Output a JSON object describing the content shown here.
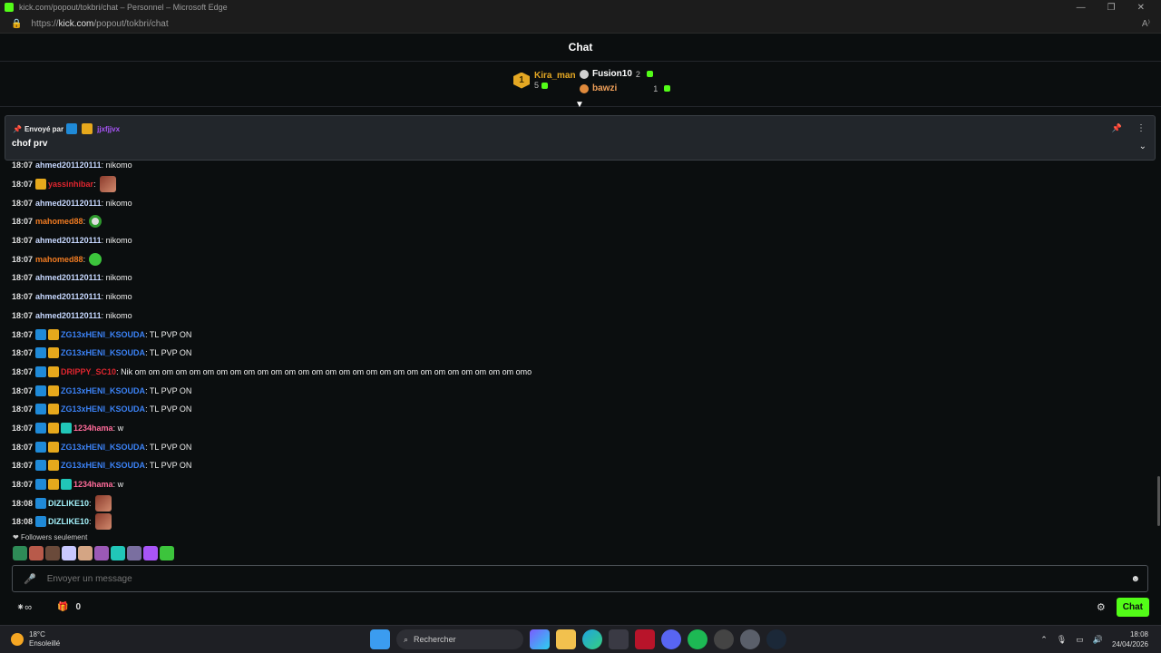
{
  "window": {
    "title": "kick.com/popout/tokbri/chat – Personnel – Microsoft Edge",
    "url_prefix": "https://",
    "url_host": "kick.com",
    "url_path": "/popout/tokbri/chat"
  },
  "header": {
    "title": "Chat"
  },
  "leaderboard": {
    "first": {
      "rank": "1",
      "name": "Kira_man",
      "count": "5"
    },
    "second": {
      "name": "Fusion10",
      "count": "2"
    },
    "third": {
      "name": "bawzi",
      "count": "1"
    }
  },
  "pinned": {
    "by_label": "Envoyé par",
    "by_user": "jjxfjjvx",
    "message": "chof prv"
  },
  "messages": [
    {
      "time": "18:07",
      "user": "ahmed201120111",
      "text": ": nikomo",
      "color": "#c7d8ff",
      "badges": [],
      "emote": ""
    },
    {
      "time": "18:07",
      "user": "yassinhibar",
      "text": ":",
      "color": "#e0262f",
      "badges": [
        "crown"
      ],
      "emote": "face"
    },
    {
      "time": "18:07",
      "user": "ahmed201120111",
      "text": ": nikomo",
      "color": "#c7d8ff",
      "badges": [],
      "emote": ""
    },
    {
      "time": "18:07",
      "user": "mahomed88",
      "text": ":",
      "color": "#f07b22",
      "badges": [],
      "emote": "skull"
    },
    {
      "time": "18:07",
      "user": "ahmed201120111",
      "text": ": nikomo",
      "color": "#c7d8ff",
      "badges": [],
      "emote": ""
    },
    {
      "time": "18:07",
      "user": "mahomed88",
      "text": ":",
      "color": "#f07b22",
      "badges": [],
      "emote": "green"
    },
    {
      "time": "18:07",
      "user": "ahmed201120111",
      "text": ": nikomo",
      "color": "#c7d8ff",
      "badges": [],
      "emote": ""
    },
    {
      "time": "18:07",
      "user": "ahmed201120111",
      "text": ": nikomo",
      "color": "#c7d8ff",
      "badges": [],
      "emote": ""
    },
    {
      "time": "18:07",
      "user": "ahmed201120111",
      "text": ": nikomo",
      "color": "#c7d8ff",
      "badges": [],
      "emote": ""
    },
    {
      "time": "18:07",
      "user": "ZG13xHENI_KSOUDA",
      "text": ": TL PVP ON",
      "color": "#3b82f6",
      "badges": [
        "blue",
        "crown"
      ],
      "emote": ""
    },
    {
      "time": "18:07",
      "user": "ZG13xHENI_KSOUDA",
      "text": ": TL PVP ON",
      "color": "#3b82f6",
      "badges": [
        "blue",
        "crown"
      ],
      "emote": ""
    },
    {
      "time": "18:07",
      "user": "DRIPPY_SC10",
      "text": ": Nik om om om om om om om om om om om om om om om om om om om om om om om om om om om om omo",
      "color": "#e0262f",
      "badges": [
        "blue",
        "crown"
      ],
      "emote": ""
    },
    {
      "time": "18:07",
      "user": "ZG13xHENI_KSOUDA",
      "text": ": TL PVP ON",
      "color": "#3b82f6",
      "badges": [
        "blue",
        "crown"
      ],
      "emote": ""
    },
    {
      "time": "18:07",
      "user": "ZG13xHENI_KSOUDA",
      "text": ": TL PVP ON",
      "color": "#3b82f6",
      "badges": [
        "blue",
        "crown"
      ],
      "emote": ""
    },
    {
      "time": "18:07",
      "user": "1234hama",
      "text": ": w",
      "color": "#ff6b9a",
      "badges": [
        "blue",
        "crown",
        "teal"
      ],
      "emote": ""
    },
    {
      "time": "18:07",
      "user": "ZG13xHENI_KSOUDA",
      "text": ": TL PVP ON",
      "color": "#3b82f6",
      "badges": [
        "blue",
        "crown"
      ],
      "emote": ""
    },
    {
      "time": "18:07",
      "user": "ZG13xHENI_KSOUDA",
      "text": ": TL PVP ON",
      "color": "#3b82f6",
      "badges": [
        "blue",
        "crown"
      ],
      "emote": ""
    },
    {
      "time": "18:07",
      "user": "1234hama",
      "text": ": w",
      "color": "#ff6b9a",
      "badges": [
        "blue",
        "crown",
        "teal"
      ],
      "emote": ""
    },
    {
      "time": "18:08",
      "user": "DIZLIKE10",
      "text": ":",
      "color": "#a5f3fc",
      "badges": [
        "blue"
      ],
      "emote": "face"
    },
    {
      "time": "18:08",
      "user": "DIZLIKE10",
      "text": ":",
      "color": "#a5f3fc",
      "badges": [
        "blue"
      ],
      "emote": "face"
    }
  ],
  "followers_only": "Followers seulement",
  "emote_bar_colors": [
    "#2e8b57",
    "#b85a4a",
    "#6a4a3a",
    "#c8c8ff",
    "#d4a584",
    "#9b59b6",
    "#21c6b8",
    "#7a6fa0",
    "#a855f7",
    "#3cc43c"
  ],
  "input": {
    "placeholder": "Envoyer un message"
  },
  "footer": {
    "gift_count": "0",
    "chat_button": "Chat"
  },
  "taskbar": {
    "temp": "18°C",
    "weather": "Ensoleillé",
    "search": "Rechercher",
    "time": "18:08",
    "date": "24/04/2026"
  }
}
